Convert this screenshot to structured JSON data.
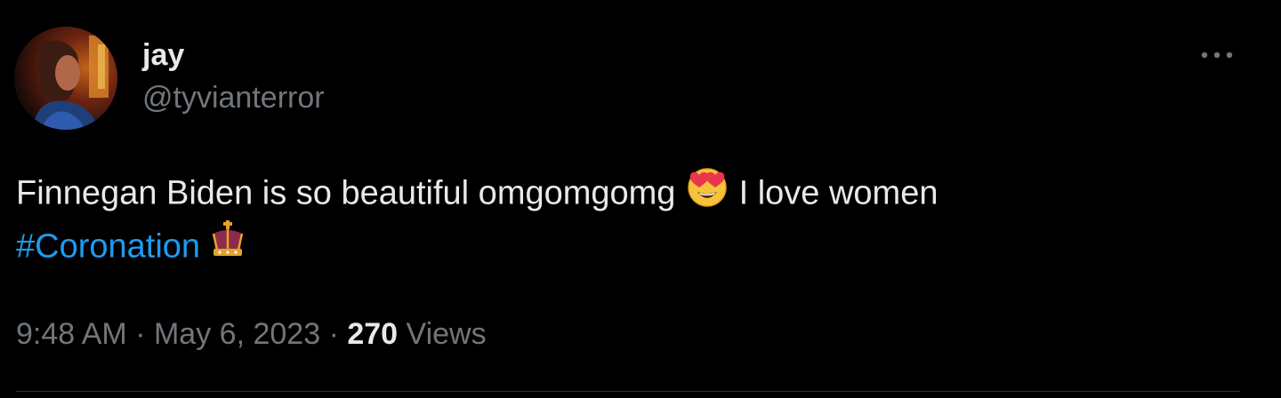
{
  "author": {
    "display_name": "jay",
    "handle": "@tyvianterror",
    "avatar_icon": "profile-photo"
  },
  "menu": {
    "icon": "more-horizontal-icon"
  },
  "tweet": {
    "text_part1": "Finnegan Biden is so beautiful omgomgomg",
    "emoji1": "smiling-face-with-heart-eyes",
    "text_part2": "I love women",
    "hashtag": "#Coronation",
    "emoji2": "crown"
  },
  "meta": {
    "time": "9:48 AM",
    "separator1": "·",
    "date": "May 6, 2023",
    "separator2": "·",
    "views_count": "270",
    "views_label": "Views"
  },
  "colors": {
    "background": "#000000",
    "text": "#e7e9ea",
    "secondary": "#71767b",
    "link": "#1d9bf0",
    "divider": "#2f3336"
  }
}
